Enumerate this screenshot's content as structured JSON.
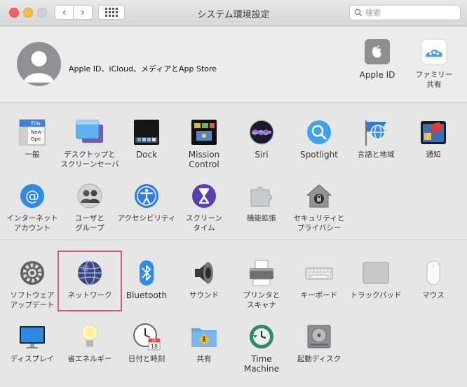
{
  "window": {
    "title": "システム環境設定"
  },
  "search": {
    "placeholder": "検索"
  },
  "account": {
    "text": "Apple ID、iCloud、メディアとApp Store",
    "apple_id_label": "Apple ID",
    "family_label": "ファミリー\n共有"
  },
  "row1": [
    {
      "label": "一般"
    },
    {
      "label": "デスクトップと\nスクリーンセーバ"
    },
    {
      "label": "Dock"
    },
    {
      "label": "Mission\nControl"
    },
    {
      "label": "Siri"
    },
    {
      "label": "Spotlight"
    },
    {
      "label": "言語と地域"
    },
    {
      "label": "通知"
    }
  ],
  "row2": [
    {
      "label": "インターネット\nアカウント"
    },
    {
      "label": "ユーザと\nグループ"
    },
    {
      "label": "アクセシビリティ"
    },
    {
      "label": "スクリーン\nタイム"
    },
    {
      "label": "機能拡張"
    },
    {
      "label": "セキュリティと\nプライバシー"
    }
  ],
  "row3": [
    {
      "label": "ソフトウェア\nアップデート"
    },
    {
      "label": "ネットワーク"
    },
    {
      "label": "Bluetooth"
    },
    {
      "label": "サウンド"
    },
    {
      "label": "プリンタと\nスキャナ"
    },
    {
      "label": "キーボード"
    },
    {
      "label": "トラックパッド"
    },
    {
      "label": "マウス"
    }
  ],
  "row4": [
    {
      "label": "ディスプレイ"
    },
    {
      "label": "省エネルギー"
    },
    {
      "label": "日付と時刻"
    },
    {
      "label": "共有"
    },
    {
      "label": "Time\nMachine"
    },
    {
      "label": "起動ディスク"
    }
  ],
  "icon_texts": {
    "general_file": "File",
    "general_new": "New",
    "general_open": "Ope",
    "calendar_month": "JUL",
    "calendar_day": "18"
  },
  "colors": {
    "selection": "#cc5e74",
    "accent": "#2f7bf6"
  }
}
